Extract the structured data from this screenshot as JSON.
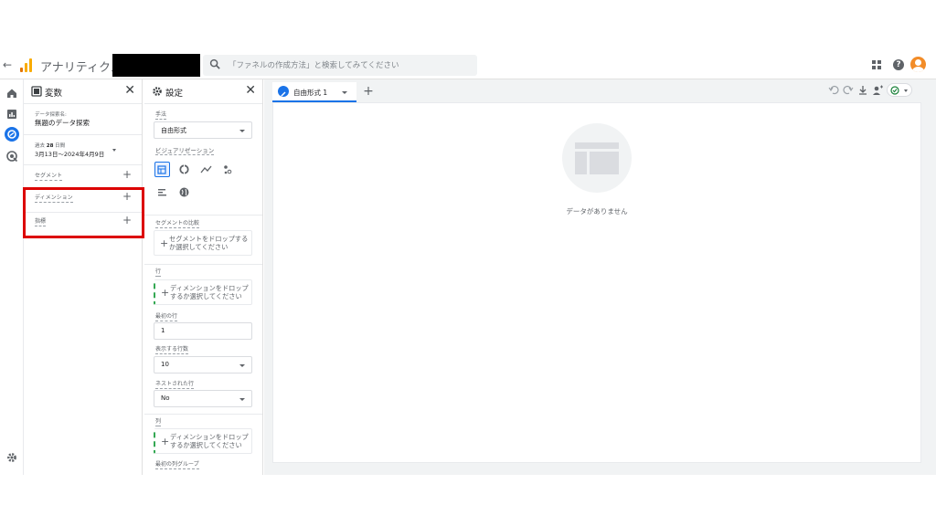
{
  "topbar": {
    "app_name": "アナリティクス",
    "search_placeholder": "「ファネルの作成方法」と検索してみてください",
    "help_label": "?"
  },
  "variables_panel": {
    "title": "変数",
    "close": "✕",
    "exploration_name_label": "データ探索名:",
    "exploration_name_value": "無題のデータ探索",
    "date_range_label_prefix": "過去",
    "date_range_days": "28",
    "date_range_label_suffix": "日間",
    "date_range_value": "3月13日～2024年4月9日",
    "segments_label": "セグメント",
    "dimensions_label": "ディメンション",
    "metrics_label": "指標",
    "plus": "+"
  },
  "settings_panel": {
    "title": "設定",
    "close": "✕",
    "technique_label": "手法",
    "technique_value": "自由形式",
    "visualization_label": "ビジュアリゼーション",
    "segment_compare_label": "セグメントの比較",
    "segment_drop_text": "セグメントをドロップするか選択してください",
    "rows_label": "行",
    "rows_drop_text": "ディメンションをドロップするか選択してください",
    "first_row_label": "最初の行",
    "first_row_value": "1",
    "rows_shown_label": "表示する行数",
    "rows_shown_value": "10",
    "nested_rows_label": "ネストされた行",
    "nested_rows_value": "No",
    "columns_label": "列",
    "columns_drop_text": "ディメンションをドロップするか選択してください",
    "first_col_group_label": "最初の列グループ",
    "plus": "+"
  },
  "canvas": {
    "tab_label": "自由形式 1",
    "add_tab": "+",
    "empty_text": "データがありません"
  },
  "colors": {
    "accent": "#1a73e8",
    "highlight": "#dc0000",
    "logo_orange": "#f9ab00",
    "logo_dark": "#e37400"
  },
  "icons": [
    "back-arrow-icon",
    "analytics-logo-icon",
    "search-icon",
    "apps-grid-icon",
    "help-icon",
    "home-icon",
    "reports-icon",
    "explore-icon",
    "advertising-icon",
    "settings-gear-icon",
    "undo-icon",
    "redo-icon",
    "download-icon",
    "share-icon",
    "check-circle-icon"
  ]
}
